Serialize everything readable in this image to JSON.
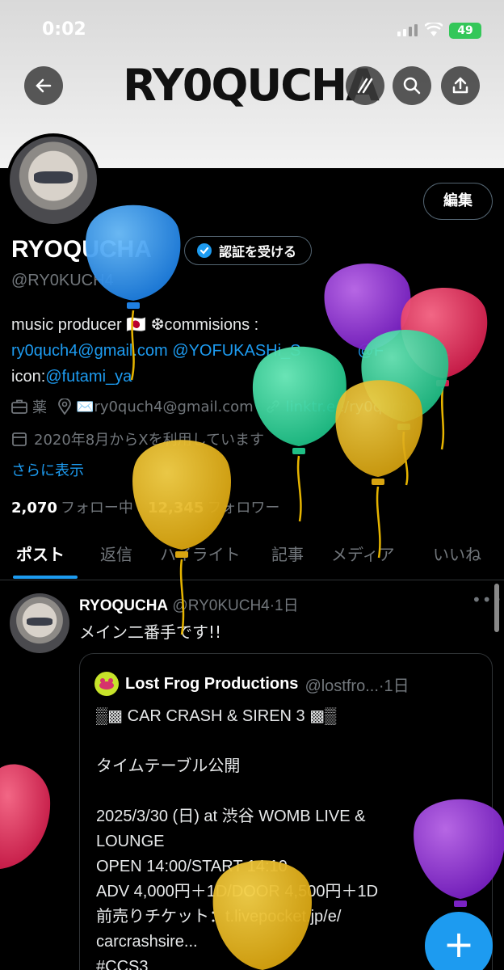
{
  "status_bar": {
    "time": "0:02",
    "battery": "49"
  },
  "header": {
    "banner_text": "RY0QUCHA"
  },
  "profile": {
    "edit_label": "編集",
    "display_name": "RYOQUCHA",
    "verify_label": "認証を受ける",
    "handle": "@RY0KUCH4",
    "bio_line1": "music producer 🇯🇵 ❆commisions :",
    "bio_email": "ry0quch4@gmail.com",
    "bio_mention1": "@YOFUKASHi_S",
    "bio_mention2": "@F",
    "bio_mention2_tail": "LL",
    "bio_icon_label": "icon:",
    "bio_icon_link": "@futami_ya",
    "occupation": "薬",
    "location": "✉️ry0quch4@gmail.com",
    "website": "linktr.ee/ry0qucha",
    "joined": "2020年8月からXを利用しています",
    "show_more": "さらに表示",
    "following_count": "2,070",
    "following_label": "フォロー中",
    "followers_count": "12,345",
    "followers_label": "フォロワー"
  },
  "tabs": [
    "ポスト",
    "返信",
    "ハイライト",
    "記事",
    "メディア",
    "いいね"
  ],
  "post": {
    "author": "RYOQUCHA",
    "handle_time": "@RY0KUCH4·1日",
    "text": "メイン二番手です!!",
    "quote": {
      "author": "Lost Frog Productions",
      "handle_time": "@lostfro...·1日",
      "lines": [
        "▒▩ CAR CRASH & SIREN 3 ▩▒",
        "",
        "タイムテーブル公開",
        "",
        "2025/3/30 (日) at 渋谷 WOMB LIVE &",
        "LOUNGE",
        "OPEN 14:00/START 14:10",
        "ADV 4,000円＋1D/DOOR 4,500円＋1D",
        "前売りチケット：t.livepocket.jp/e/",
        "carcrashsire...",
        "#CCS3"
      ]
    }
  },
  "fab_label": "+",
  "colors": {
    "accent": "#1d9bf0",
    "background": "#000000",
    "muted": "#71767b"
  }
}
